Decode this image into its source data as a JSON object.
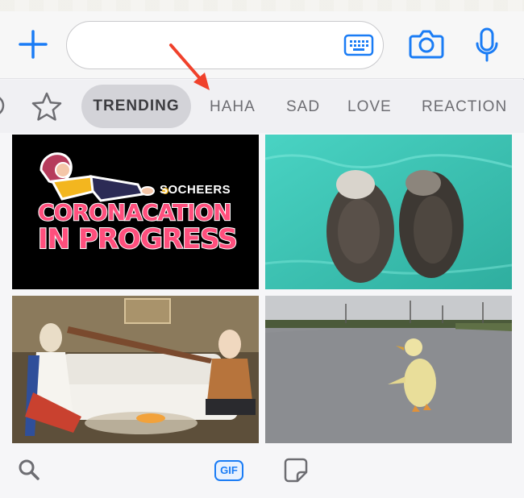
{
  "composer": {
    "input_value": "",
    "input_placeholder": "",
    "icons": [
      "plus-icon",
      "keyboard-icon",
      "camera-icon",
      "microphone-icon"
    ]
  },
  "categories": {
    "icons": [
      "recent-icon",
      "star-icon"
    ],
    "items": [
      {
        "label": "TRENDING",
        "selected": true
      },
      {
        "label": "HAHA",
        "selected": false
      },
      {
        "label": "SAD",
        "selected": false
      },
      {
        "label": "LOVE",
        "selected": false
      },
      {
        "label": "REACTION",
        "selected": false
      }
    ]
  },
  "gifs": [
    {
      "brand": "SOCHEERS",
      "line1": "CORONACATION",
      "line2": "IN PROGRESS"
    },
    {
      "subject": "otters"
    },
    {
      "subject": "talk-show"
    },
    {
      "subject": "duck"
    }
  ],
  "bottombar": {
    "gif_label": "GIF",
    "icons": [
      "search-icon",
      "gif-icon",
      "sticker-icon"
    ]
  },
  "colors": {
    "accent": "#1a7cf5",
    "annotation_arrow": "#f0412b",
    "sticker_pink": "#ff4f7d"
  }
}
